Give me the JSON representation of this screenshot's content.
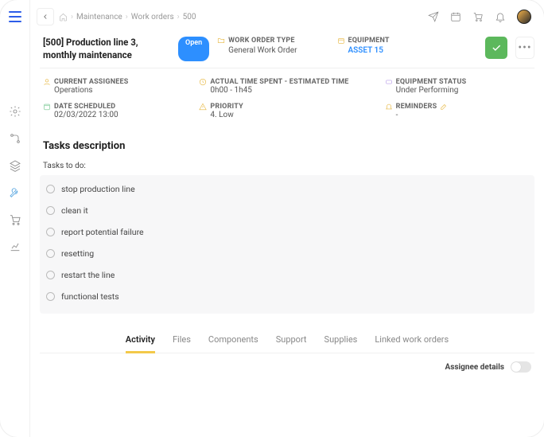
{
  "breadcrumb": {
    "a": "Maintenance",
    "b": "Work orders",
    "c": "500"
  },
  "wo": {
    "title": "[500] Production line 3, monthly maintenance",
    "status": "Open",
    "type_label": "WORK ORDER TYPE",
    "type_value": "General Work Order",
    "equipment_label": "EQUIPMENT",
    "equipment_value": "ASSET 15"
  },
  "meta": {
    "assignees_label": "CURRENT ASSIGNEES",
    "assignees_value": "Operations",
    "time_label": "ACTUAL TIME SPENT - ESTIMATED TIME",
    "time_value": "0h00 - 1h45",
    "equip_status_label": "EQUIPMENT STATUS",
    "equip_status_value": "Under Performing",
    "date_label": "DATE SCHEDULED",
    "date_value": "02/03/2022 13:00",
    "priority_label": "PRIORITY",
    "priority_value": "4. Low",
    "reminders_label": "REMINDERS",
    "reminders_value": "-"
  },
  "tasks": {
    "section": "Tasks description",
    "label": "Tasks to do:",
    "items": [
      "stop production line",
      "clean it",
      "report potential failure",
      "resetting",
      "restart the line",
      "functional tests"
    ]
  },
  "tabs": [
    "Activity",
    "Files",
    "Components",
    "Support",
    "Supplies",
    "Linked work orders"
  ],
  "assignee_details": "Assignee details"
}
